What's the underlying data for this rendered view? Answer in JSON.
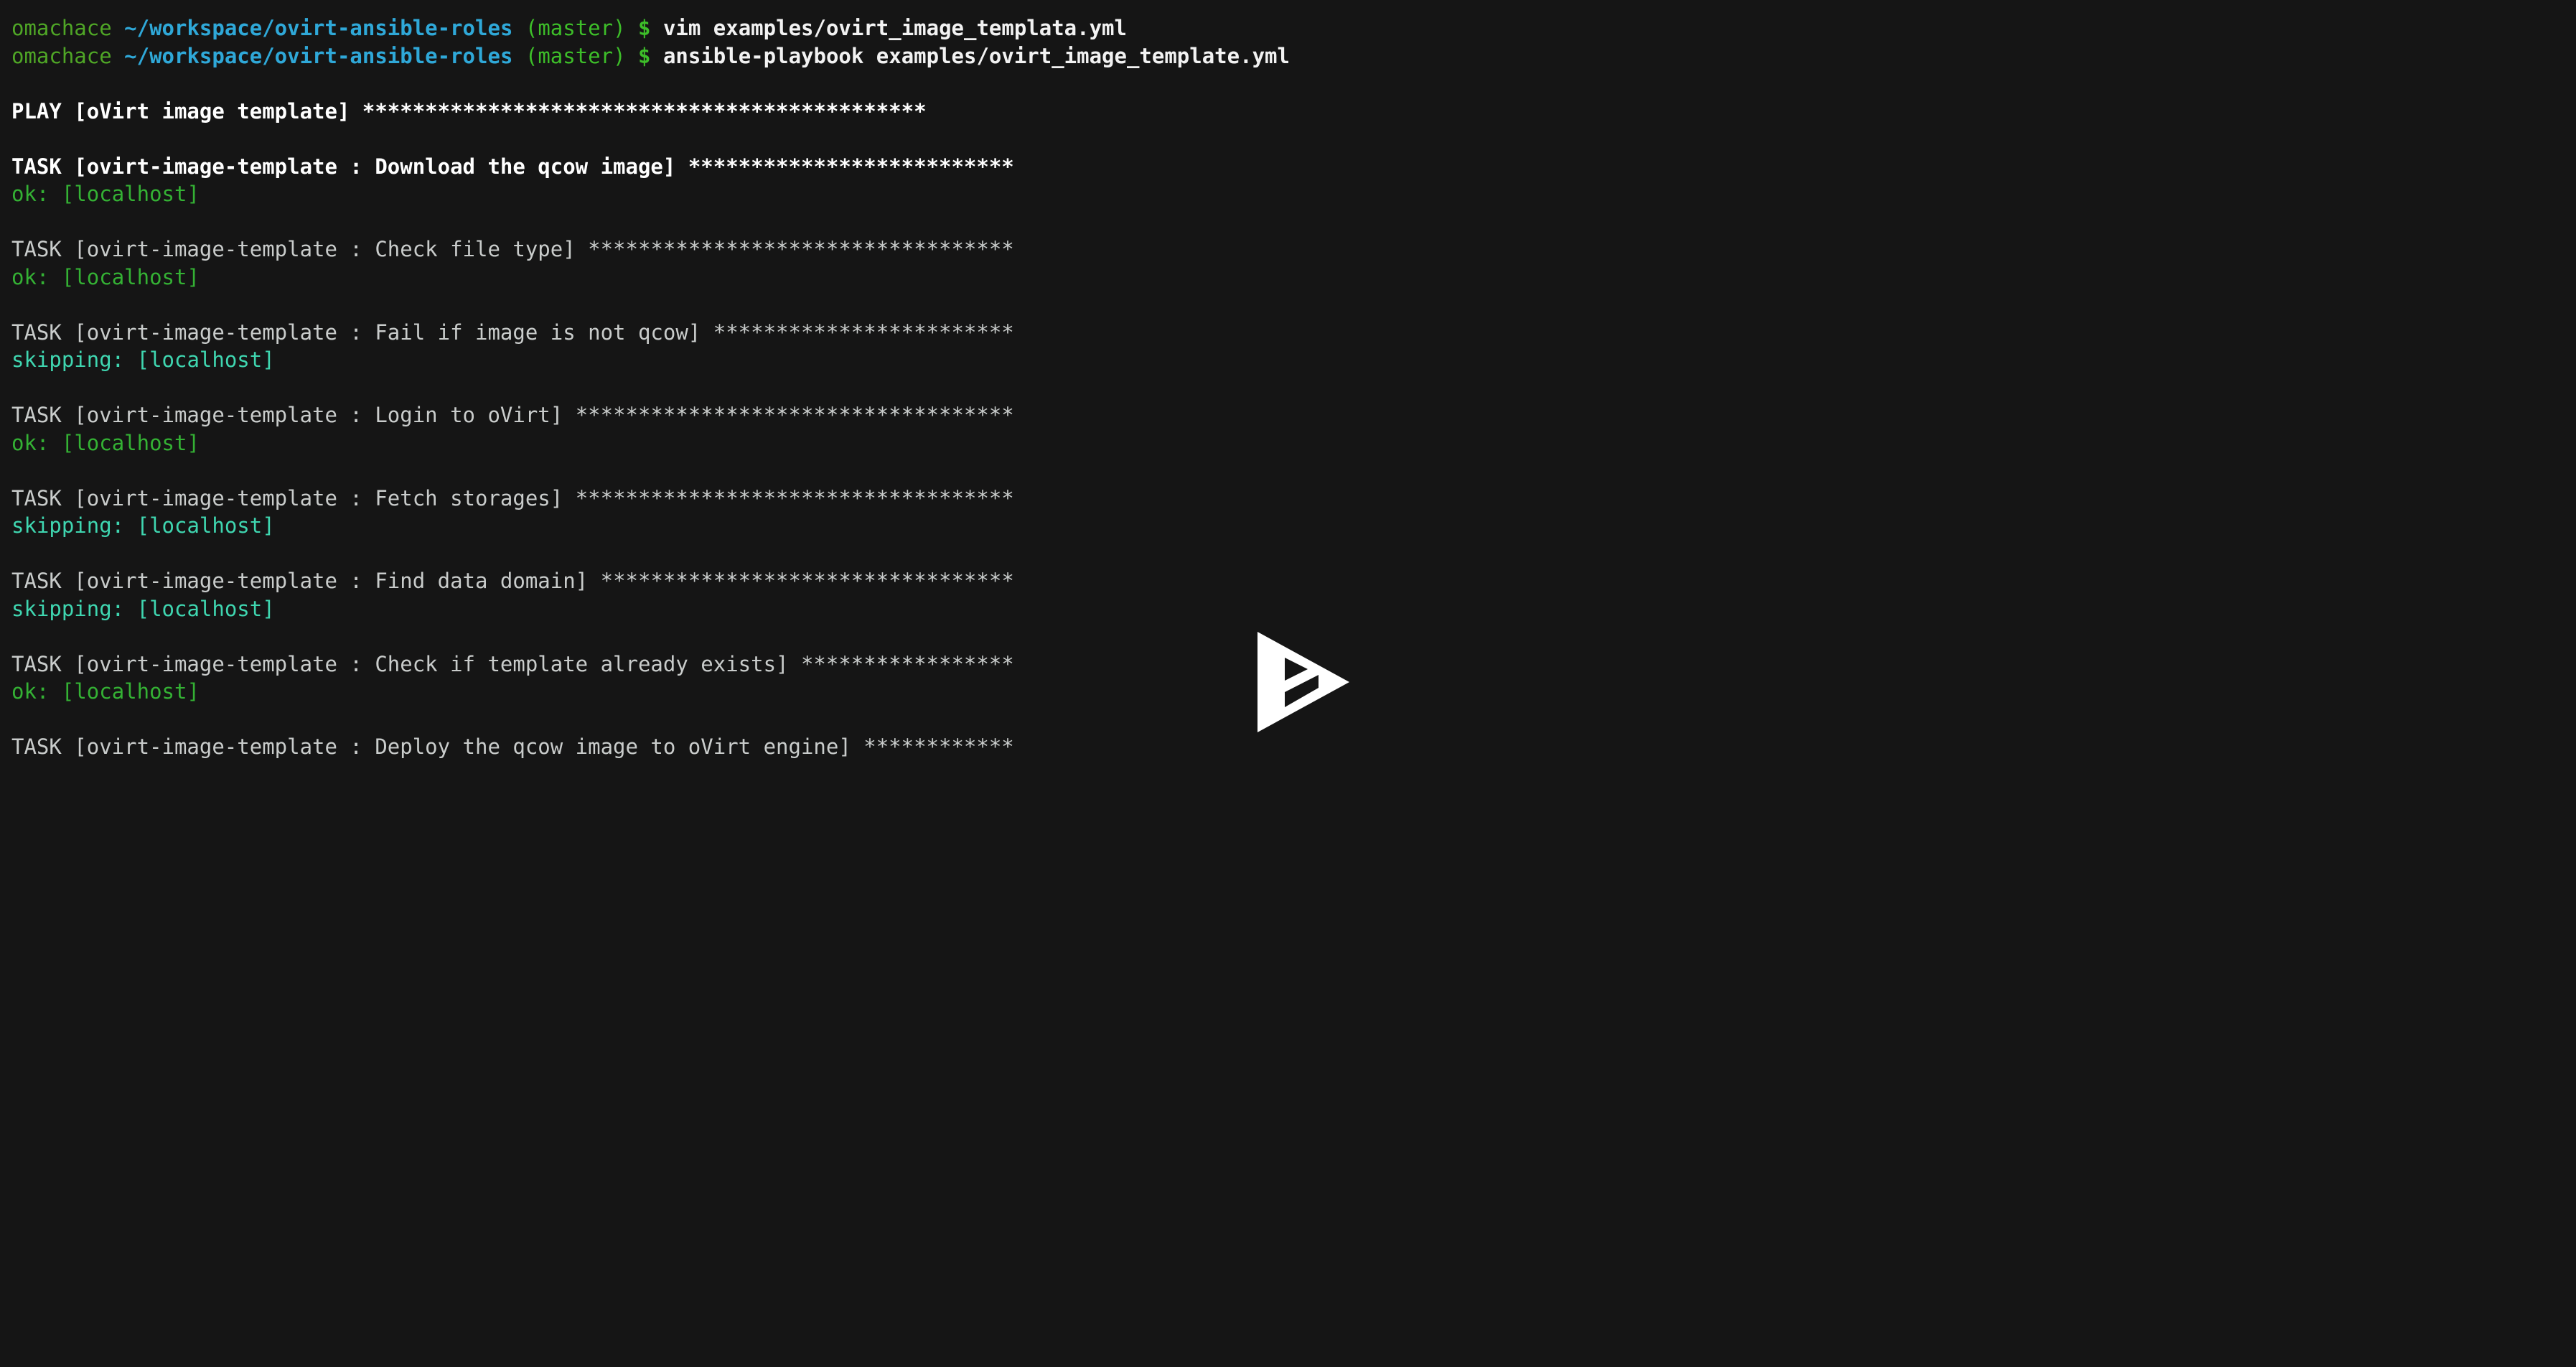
{
  "terminal": {
    "background_color": "#151515",
    "colors": {
      "prompt_user": "#4FA626",
      "prompt_path": "#2FA8D8",
      "prompt_branch": "#3DBE29",
      "prompt_symbol": "#3DBE29",
      "command": "#F2F2F2",
      "play_header": "#FFFFFF",
      "task_header_bold": "#FFFFFF",
      "task_header": "#C9CCCB",
      "status_ok": "#34B134",
      "status_skipping": "#3FD6B0"
    },
    "prompt": {
      "user": "omachace",
      "path": "~/workspace/ovirt-ansible-roles",
      "branch": "(master)",
      "symbol": "$"
    },
    "commands": [
      "vim examples/ovirt_image_templata.yml",
      "ansible-playbook examples/ovirt_image_template.yml"
    ],
    "play": {
      "label": "PLAY [oVirt image template] ",
      "stars": "*********************************************"
    },
    "tasks": [
      {
        "label": "TASK [ovirt-image-template : Download the qcow image] ",
        "stars": "**************************",
        "bold": true,
        "status_label": "ok:",
        "status_host": "[localhost]",
        "status_kind": "ok"
      },
      {
        "label": "TASK [ovirt-image-template : Check file type] ",
        "stars": "**********************************",
        "bold": false,
        "status_label": "ok:",
        "status_host": "[localhost]",
        "status_kind": "ok"
      },
      {
        "label": "TASK [ovirt-image-template : Fail if image is not qcow] ",
        "stars": "************************",
        "bold": false,
        "status_label": "skipping:",
        "status_host": "[localhost]",
        "status_kind": "skipping"
      },
      {
        "label": "TASK [ovirt-image-template : Login to oVirt] ",
        "stars": "***********************************",
        "bold": false,
        "status_label": "ok:",
        "status_host": "[localhost]",
        "status_kind": "ok"
      },
      {
        "label": "TASK [ovirt-image-template : Fetch storages] ",
        "stars": "***********************************",
        "bold": false,
        "status_label": "skipping:",
        "status_host": "[localhost]",
        "status_kind": "skipping"
      },
      {
        "label": "TASK [ovirt-image-template : Find data domain] ",
        "stars": "*********************************",
        "bold": false,
        "status_label": "skipping:",
        "status_host": "[localhost]",
        "status_kind": "skipping"
      },
      {
        "label": "TASK [ovirt-image-template : Check if template already exists] ",
        "stars": "*****************",
        "bold": false,
        "status_label": "ok:",
        "status_host": "[localhost]",
        "status_kind": "ok"
      },
      {
        "label": "TASK [ovirt-image-template : Deploy the qcow image to oVirt engine] ",
        "stars": "************",
        "bold": false,
        "status_label": "",
        "status_host": "",
        "status_kind": "none"
      }
    ]
  },
  "player": {
    "play_button_label": "Play",
    "play_button_color": "#FFFFFF"
  }
}
